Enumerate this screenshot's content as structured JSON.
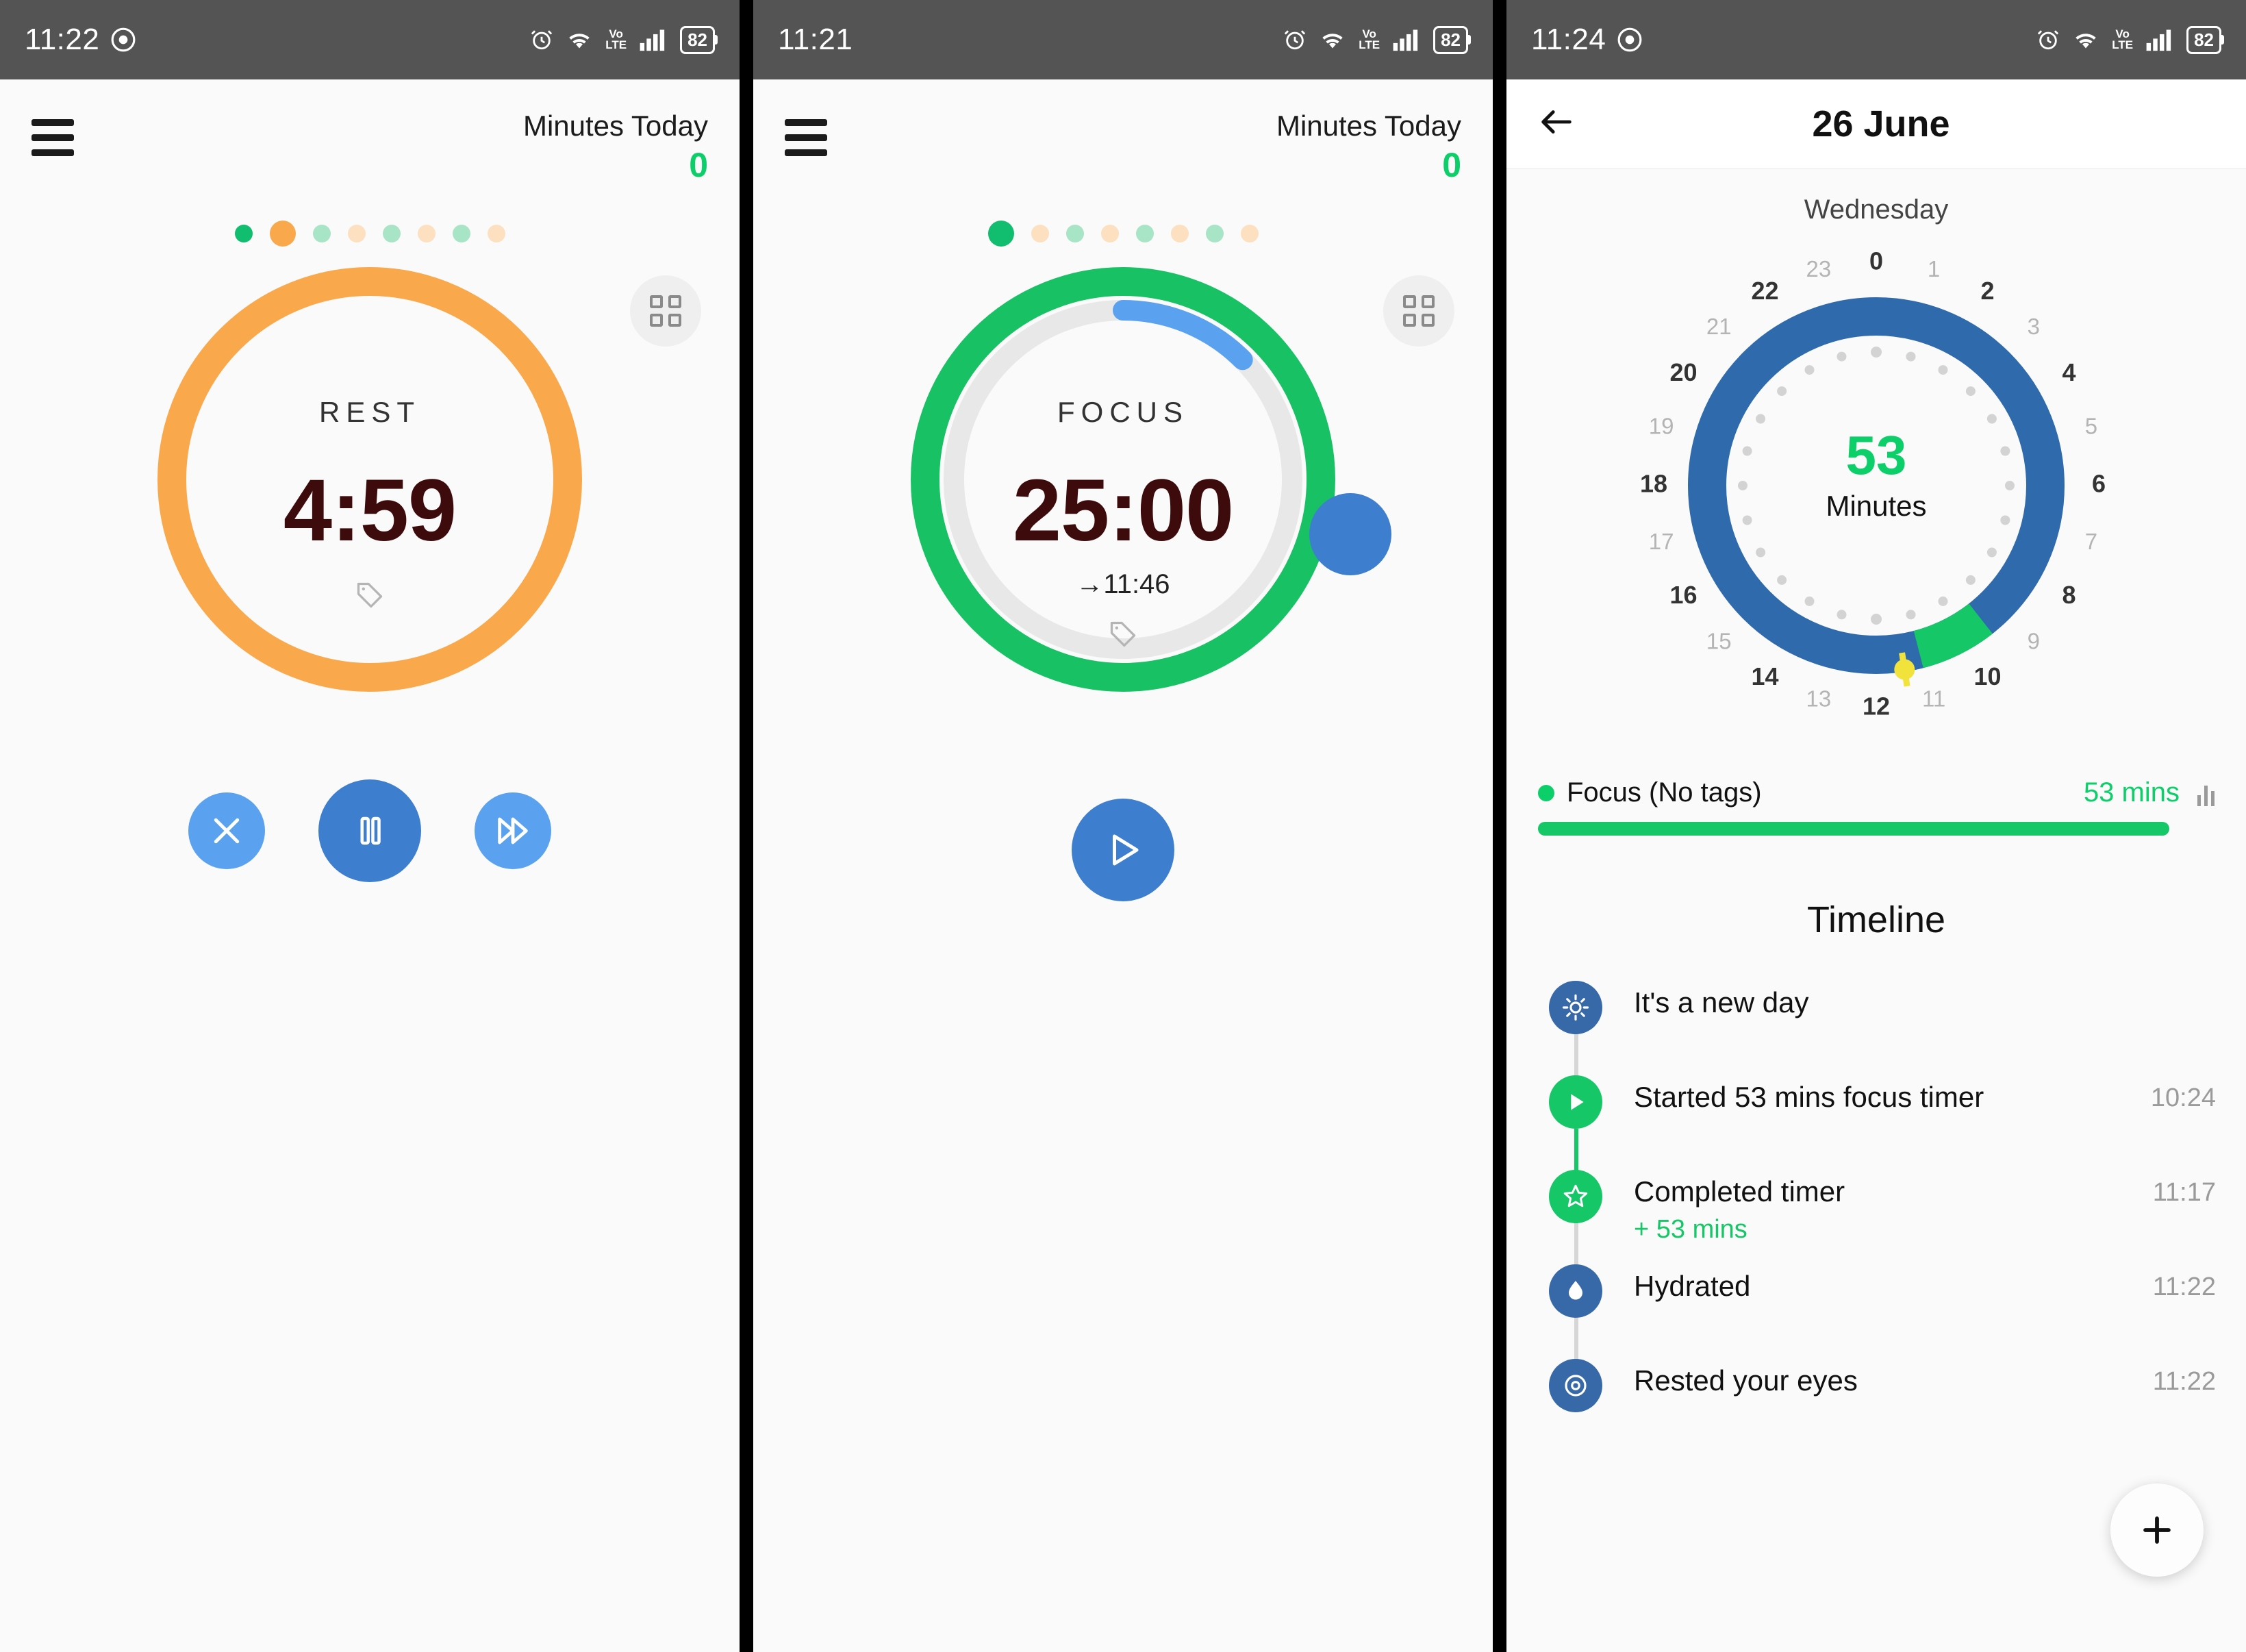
{
  "panels": [
    {
      "status": {
        "time": "11:22",
        "battery": "82",
        "volte": "VoLTE",
        "alarm_icon": "alarm-icon",
        "wifi_icon": "wifi-icon",
        "signal_icon": "signal-icon",
        "battery_icon": "battery-icon",
        "record_icon": "screen-record-icon"
      },
      "header": {
        "menu_icon": "hamburger-menu-icon",
        "minutes_label": "Minutes Today",
        "minutes_value": "0"
      },
      "dots": [
        {
          "color": "#11bd6e",
          "size": "small"
        },
        {
          "color": "#f9a84b",
          "size": "big"
        },
        {
          "color": "#a8e5c6",
          "size": "small"
        },
        {
          "color": "#fce0c0",
          "size": "small"
        },
        {
          "color": "#a8e5c6",
          "size": "small"
        },
        {
          "color": "#fce0c0",
          "size": "small"
        },
        {
          "color": "#a8e5c6",
          "size": "small"
        },
        {
          "color": "#fce0c0",
          "size": "small"
        }
      ],
      "timer": {
        "mode": "REST",
        "time": "4:59",
        "eta": "",
        "tag_icon": "tag-icon"
      },
      "grid_button": {
        "icon": "grid-view-icon"
      },
      "controls": [
        {
          "name": "cancel-button",
          "icon": "close-icon"
        },
        {
          "name": "pause-button",
          "icon": "pause-icon"
        },
        {
          "name": "skip-button",
          "icon": "fast-forward-icon"
        }
      ]
    },
    {
      "status": {
        "time": "11:21",
        "battery": "82",
        "volte": "VoLTE"
      },
      "header": {
        "menu_icon": "hamburger-menu-icon",
        "minutes_label": "Minutes Today",
        "minutes_value": "0"
      },
      "dots": [
        {
          "color": "#11bd6e",
          "size": "big"
        },
        {
          "color": "#fce0c0",
          "size": "small"
        },
        {
          "color": "#a8e5c6",
          "size": "small"
        },
        {
          "color": "#fce0c0",
          "size": "small"
        },
        {
          "color": "#a8e5c6",
          "size": "small"
        },
        {
          "color": "#fce0c0",
          "size": "small"
        },
        {
          "color": "#a8e5c6",
          "size": "small"
        },
        {
          "color": "#fce0c0",
          "size": "small"
        }
      ],
      "timer": {
        "mode": "FOCUS",
        "time": "25:00",
        "eta": "→11:46",
        "tag_icon": "tag-icon"
      },
      "grid_button": {
        "icon": "grid-view-icon"
      },
      "play_button": {
        "icon": "play-icon"
      }
    }
  ],
  "day": {
    "status": {
      "time": "11:24",
      "battery": "82",
      "volte": "VoLTE"
    },
    "appbar": {
      "back_icon": "back-arrow-icon",
      "title": "26 June"
    },
    "weekday": "Wednesday",
    "clock": {
      "hours": [
        "0",
        "1",
        "2",
        "3",
        "4",
        "5",
        "6",
        "7",
        "8",
        "9",
        "10",
        "11",
        "12",
        "13",
        "14",
        "15",
        "16",
        "17",
        "18",
        "19",
        "20",
        "21",
        "22",
        "23"
      ],
      "center_value": "53",
      "center_unit": "Minutes"
    },
    "stat": {
      "label": "Focus (No tags)",
      "value": "53 mins",
      "chart_icon": "bar-chart-icon",
      "dot_color": "#0ccf6a",
      "bar_color": "#16c767"
    },
    "timeline_title": "Timeline",
    "timeline": [
      {
        "icon": "sun-icon",
        "icon_bg": "#3769a8",
        "line_color": "#d6d6d6",
        "text": "It's a new day",
        "sub": "",
        "time": ""
      },
      {
        "icon": "play-icon",
        "icon_bg": "#16c767",
        "line_color": "#16c767",
        "text": "Started 53 mins focus timer",
        "sub": "",
        "time": "10:24"
      },
      {
        "icon": "star-icon",
        "icon_bg": "#16c767",
        "line_color": "#d6d6d6",
        "text": "Completed timer",
        "sub": "+ 53 mins",
        "time": "11:17"
      },
      {
        "icon": "water-drop-icon",
        "icon_bg": "#3769a8",
        "line_color": "#d6d6d6",
        "text": "Hydrated",
        "sub": "",
        "time": "11:22"
      },
      {
        "icon": "eye-icon",
        "icon_bg": "#3769a8",
        "line_color": "#d6d6d6",
        "text": "Rested your eyes",
        "sub": "",
        "time": "11:22"
      }
    ],
    "fab": {
      "icon": "plus-icon"
    }
  },
  "chart_data": {
    "type": "pie",
    "title": "24-hour focus ring — 26 June (Wednesday)",
    "subtitle": "53 Minutes",
    "axis": "24h clock, hour 0 at top, clockwise",
    "tick_labels": [
      "0",
      "1",
      "2",
      "3",
      "4",
      "5",
      "6",
      "7",
      "8",
      "9",
      "10",
      "11",
      "12",
      "13",
      "14",
      "15",
      "16",
      "17",
      "18",
      "19",
      "20",
      "21",
      "22",
      "23"
    ],
    "track_color": "#2f6aac",
    "segments": [
      {
        "name": "Focus (No tags)",
        "start_hour": 10.4,
        "end_hour": 11.283,
        "minutes": 53,
        "color": "#16c767"
      }
    ],
    "markers": [
      {
        "name": "current-time-marker",
        "hour": 11.4,
        "color": "#f2e33c"
      }
    ],
    "legend": [
      {
        "label": "Focus (No tags)",
        "value": "53 mins",
        "color": "#16c767"
      }
    ],
    "legend_position": "below"
  }
}
